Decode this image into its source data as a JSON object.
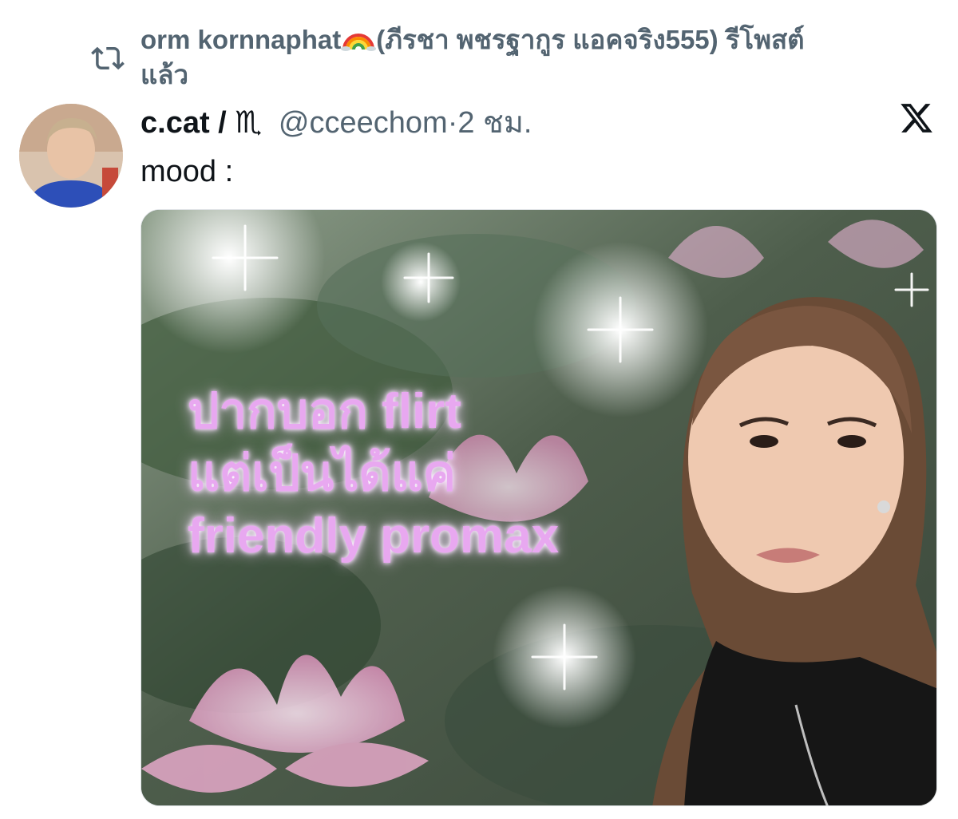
{
  "repost": {
    "icon": "repost-icon",
    "name": "orm kornnaphat",
    "emoji": "rainbow-emoji",
    "suffix": "(ภีรชา พชรฐากูร แอคจริง555) รีโพสต์แล้ว"
  },
  "tweet": {
    "display_name": "c.cat / ♏",
    "handle": "@cceechom",
    "separator": "·",
    "time": "2 ชม.",
    "text": "mood :",
    "platform_icon": "x-logo-icon"
  },
  "media": {
    "caption": "ปากบอก flirt\nแต่เป็นได้แค่\nfriendly promax",
    "caption_color": "#e8a8f0"
  },
  "colors": {
    "text_primary": "#0f1419",
    "text_secondary": "#536471",
    "background": "#ffffff"
  }
}
